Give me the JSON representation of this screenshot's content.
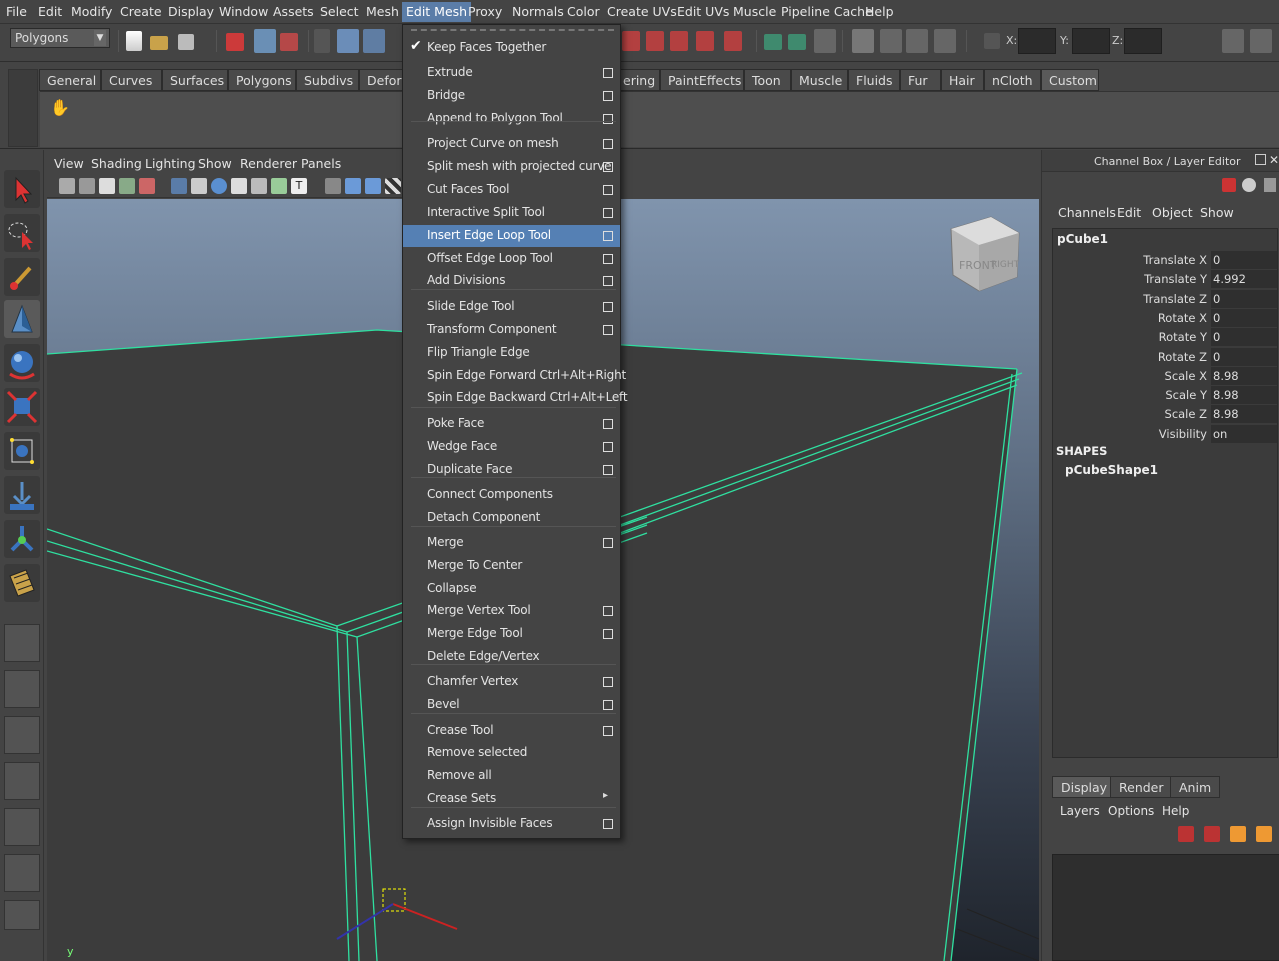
{
  "menubar": {
    "items": [
      "File",
      "Edit",
      "Modify",
      "Create",
      "Display",
      "Window",
      "Assets",
      "Select",
      "Mesh",
      "Edit Mesh",
      "Proxy",
      "Normals",
      "Color",
      "Create UVs",
      "Edit UVs",
      "Muscle",
      "Pipeline Cache",
      "Help"
    ],
    "active": "Edit Mesh"
  },
  "status": {
    "mode": "Polygons",
    "x_label": "X:",
    "y_label": "Y:",
    "z_label": "Z:"
  },
  "shelf": {
    "tabs": [
      "General",
      "Curves",
      "Surfaces",
      "Polygons",
      "Subdivs",
      "Deform",
      "ering",
      "PaintEffects",
      "Toon",
      "Muscle",
      "Fluids",
      "Fur",
      "Hair",
      "nCloth",
      "Custom"
    ],
    "active_tab": "Custom"
  },
  "panel": {
    "menus": [
      "View",
      "Shading",
      "Lighting",
      "Show",
      "Renderer",
      "Panels"
    ]
  },
  "viewcube": {
    "front": "FRONT",
    "right": "RIGHT"
  },
  "axis": {
    "y": "y"
  },
  "dropdown": {
    "items": [
      {
        "label": "Keep Faces Together",
        "checked": true
      },
      {
        "label": "Extrude",
        "option": true
      },
      {
        "label": "Bridge",
        "option": true
      },
      {
        "label": "Append to Polygon Tool",
        "option": true
      },
      {
        "label": "Project Curve on mesh",
        "option": true
      },
      {
        "label": "Split mesh with projected curve",
        "option": true
      },
      {
        "label": "Cut Faces Tool",
        "option": true
      },
      {
        "label": "Interactive Split Tool",
        "option": true
      },
      {
        "label": "Insert Edge Loop Tool",
        "option": true,
        "highlighted": true
      },
      {
        "label": "Offset Edge Loop Tool",
        "option": true
      },
      {
        "label": "Add Divisions",
        "option": true
      },
      {
        "label": "Slide Edge Tool",
        "option": true
      },
      {
        "label": "Transform Component",
        "option": true
      },
      {
        "label": "Flip Triangle Edge"
      },
      {
        "label": "Spin Edge Forward  Ctrl+Alt+Right"
      },
      {
        "label": "Spin Edge Backward  Ctrl+Alt+Left"
      },
      {
        "label": "Poke Face",
        "option": true
      },
      {
        "label": "Wedge Face",
        "option": true
      },
      {
        "label": "Duplicate Face",
        "option": true
      },
      {
        "label": "Connect Components"
      },
      {
        "label": "Detach Component"
      },
      {
        "label": "Merge",
        "option": true
      },
      {
        "label": "Merge To Center"
      },
      {
        "label": "Collapse"
      },
      {
        "label": "Merge Vertex Tool",
        "option": true
      },
      {
        "label": "Merge Edge Tool",
        "option": true
      },
      {
        "label": "Delete Edge/Vertex"
      },
      {
        "label": "Chamfer Vertex",
        "option": true
      },
      {
        "label": "Bevel",
        "option": true
      },
      {
        "label": "Crease Tool",
        "option": true
      },
      {
        "label": "Remove selected"
      },
      {
        "label": "Remove all"
      },
      {
        "label": "Crease Sets",
        "submenu": true
      },
      {
        "label": "Assign Invisible Faces",
        "option": true
      }
    ]
  },
  "channelbox": {
    "title": "Channel Box / Layer Editor",
    "menus": [
      "Channels",
      "Edit",
      "Object",
      "Show"
    ],
    "object": "pCube1",
    "attributes": [
      {
        "label": "Translate X",
        "value": "0"
      },
      {
        "label": "Translate Y",
        "value": "4.992"
      },
      {
        "label": "Translate Z",
        "value": "0"
      },
      {
        "label": "Rotate X",
        "value": "0"
      },
      {
        "label": "Rotate Y",
        "value": "0"
      },
      {
        "label": "Rotate Z",
        "value": "0"
      },
      {
        "label": "Scale X",
        "value": "8.98"
      },
      {
        "label": "Scale Y",
        "value": "8.98"
      },
      {
        "label": "Scale Z",
        "value": "8.98"
      },
      {
        "label": "Visibility",
        "value": "on"
      }
    ],
    "shapes_label": "SHAPES",
    "shape": "pCubeShape1"
  },
  "layers": {
    "tabs": [
      "Display",
      "Render",
      "Anim"
    ],
    "active_tab": "Display",
    "menus": [
      "Layers",
      "Options",
      "Help"
    ]
  }
}
